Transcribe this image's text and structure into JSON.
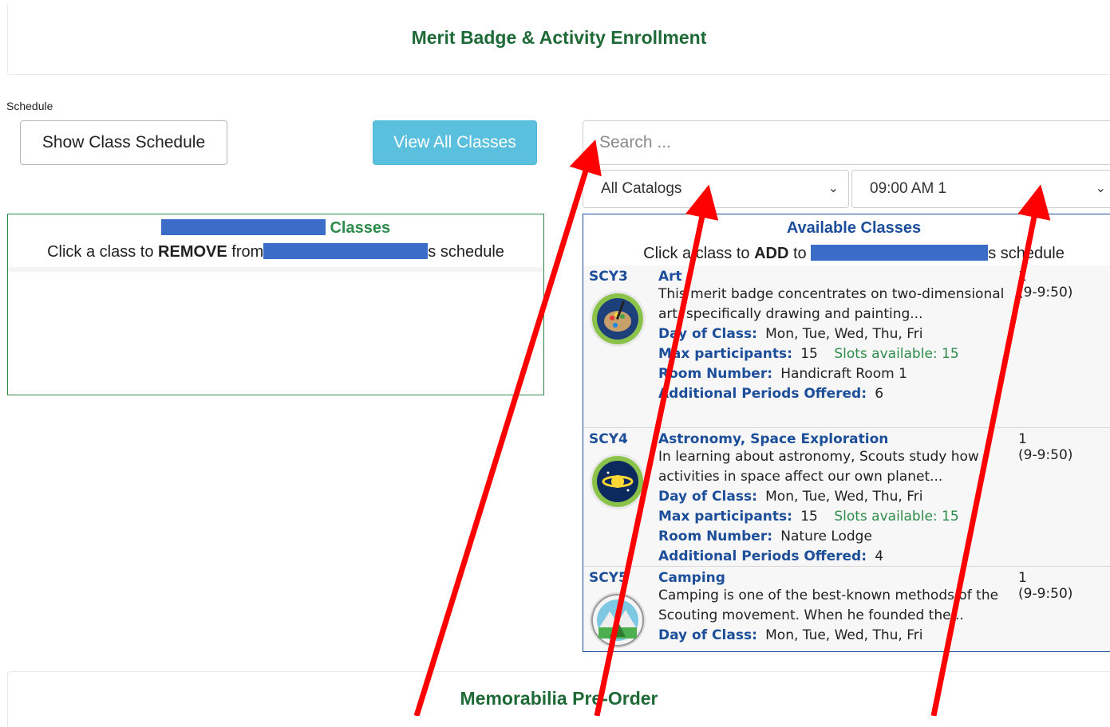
{
  "enrollment": {
    "title": "Merit Badge & Activity Enrollment"
  },
  "schedule_label": "Schedule",
  "buttons": {
    "show_schedule": "Show Class Schedule",
    "view_all": "View All Classes"
  },
  "search": {
    "placeholder": "Search ..."
  },
  "filters": {
    "catalog": "All Catalogs",
    "period": "09:00 AM 1"
  },
  "my_classes": {
    "heading": "Classes",
    "sub_prefix": "Click a class to ",
    "sub_action": "REMOVE",
    "sub_mid": " from",
    "sub_suffix": "s schedule"
  },
  "available": {
    "heading": "Available Classes",
    "sub_prefix": "Click a class to ",
    "sub_action": "ADD",
    "sub_mid": " to ",
    "sub_suffix": "s schedule",
    "labels": {
      "day": "Day of Class:",
      "max": "Max participants:",
      "slots": "Slots available:",
      "room": "Room Number:",
      "additional": "Additional Periods Offered:"
    },
    "classes": [
      {
        "code": "SCY3",
        "name": "Art",
        "desc": "This merit badge concentrates on two-dimensional art, specifically drawing and painting...",
        "day": "Mon, Tue, Wed, Thu, Fri",
        "max": "15",
        "slots": "15",
        "room": "Handicraft Room 1",
        "additional": "6",
        "period_num": "1",
        "period_time": "(9-9:50)",
        "icon": "art-badge-icon"
      },
      {
        "code": "SCY4",
        "name": "Astronomy, Space Exploration",
        "desc": "In learning about astronomy, Scouts study how activities in space affect our own planet...",
        "day": "Mon, Tue, Wed, Thu, Fri",
        "max": "15",
        "slots": "15",
        "room": "Nature Lodge",
        "additional": "4",
        "period_num": "1",
        "period_time": "(9-9:50)",
        "icon": "astronomy-badge-icon"
      },
      {
        "code": "SCY5",
        "name": "Camping",
        "desc": "Camping is one of the best-known methods of the Scouting movement. When he founded the...",
        "day": "Mon, Tue, Wed, Thu, Fri",
        "period_num": "1",
        "period_time": "(9-9:50)",
        "icon": "camping-badge-icon"
      }
    ]
  },
  "memorabilia": {
    "title": "Memorabilia Pre-Order"
  },
  "colors": {
    "green": "#1e6a36",
    "blue": "#1d4e9a",
    "info": "#5bc0de",
    "annotation": "#ff0000",
    "redaction": "#3b6cc8"
  }
}
